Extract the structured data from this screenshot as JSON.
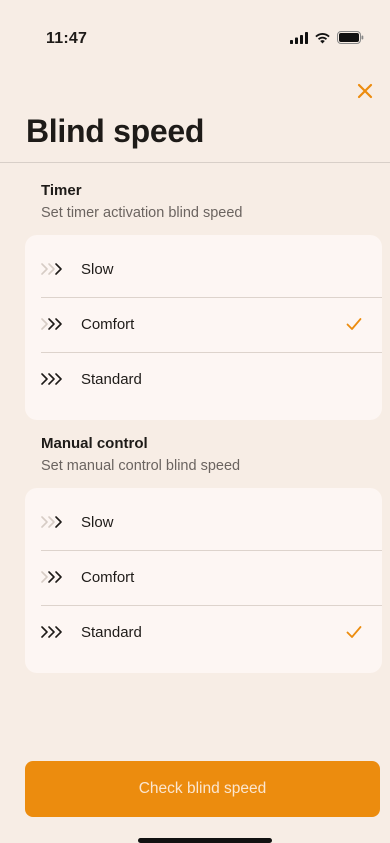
{
  "status_bar": {
    "time": "11:47",
    "icons": [
      "signal-icon",
      "wifi-icon",
      "battery-icon"
    ]
  },
  "header": {
    "title": "Blind speed",
    "close_icon": "close-icon"
  },
  "colors": {
    "accent": "#EC8C0E",
    "background": "#F7EDE5",
    "card": "#FDF6F3",
    "text": "#1E1B18",
    "subtext": "#6B6460"
  },
  "sections": [
    {
      "title": "Timer",
      "subtitle": "Set timer activation blind speed",
      "options": [
        {
          "label": "Slow",
          "level": 1,
          "selected": false
        },
        {
          "label": "Comfort",
          "level": 2,
          "selected": true
        },
        {
          "label": "Standard",
          "level": 3,
          "selected": false
        }
      ]
    },
    {
      "title": "Manual control",
      "subtitle": "Set manual control blind speed",
      "options": [
        {
          "label": "Slow",
          "level": 1,
          "selected": false
        },
        {
          "label": "Comfort",
          "level": 2,
          "selected": false
        },
        {
          "label": "Standard",
          "level": 3,
          "selected": true
        }
      ]
    }
  ],
  "footer": {
    "button_label": "Check blind speed"
  }
}
